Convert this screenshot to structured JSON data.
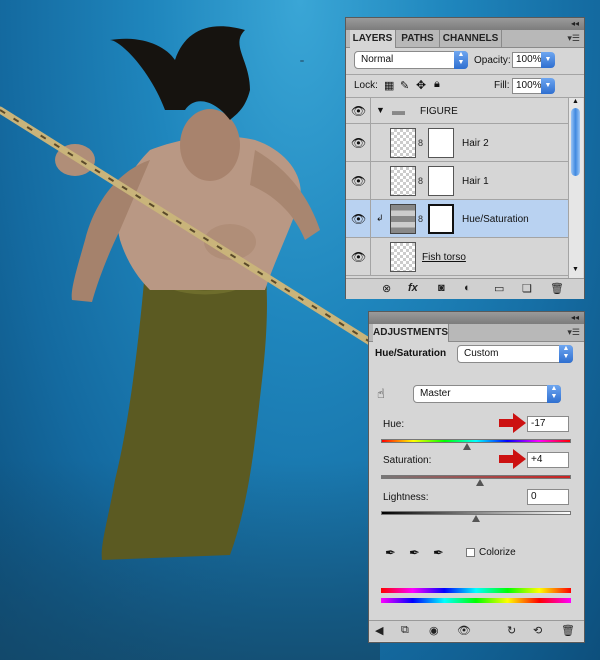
{
  "layers_panel": {
    "tabs": [
      "LAYERS",
      "PATHS",
      "CHANNELS"
    ],
    "blend_mode": "Normal",
    "opacity_label": "Opacity:",
    "opacity_value": "100%",
    "lock_label": "Lock:",
    "fill_label": "Fill:",
    "fill_value": "100%",
    "layers": [
      {
        "name": "FIGURE",
        "type": "group"
      },
      {
        "name": "Hair 2",
        "type": "layer"
      },
      {
        "name": "Hair 1",
        "type": "layer"
      },
      {
        "name": "Hue/Saturation",
        "type": "adjustment",
        "selected": true
      },
      {
        "name": "Fish torso",
        "type": "layer"
      }
    ],
    "bottom_icons": [
      "link-icon",
      "fx-icon",
      "mask-icon",
      "adjustment-icon",
      "folder-icon",
      "new-layer-icon",
      "trash-icon"
    ],
    "fx_label": "fx"
  },
  "adjustments_panel": {
    "tab": "ADJUSTMENTS",
    "title": "Hue/Saturation",
    "preset": "Custom",
    "channel": "Master",
    "hue_label": "Hue:",
    "hue_value": "-17",
    "saturation_label": "Saturation:",
    "saturation_value": "+4",
    "lightness_label": "Lightness:",
    "lightness_value": "0",
    "colorize_label": "Colorize",
    "colorize_checked": false,
    "hue_slider_fraction": 0.453,
    "saturation_slider_fraction": 0.52,
    "lightness_slider_fraction": 0.5
  },
  "colors": {
    "panel_bg": "#d6d6d6",
    "selection": "#b9d2f1",
    "accent_blue": "#2f6fd0",
    "red_arrow": "#cc1111"
  }
}
